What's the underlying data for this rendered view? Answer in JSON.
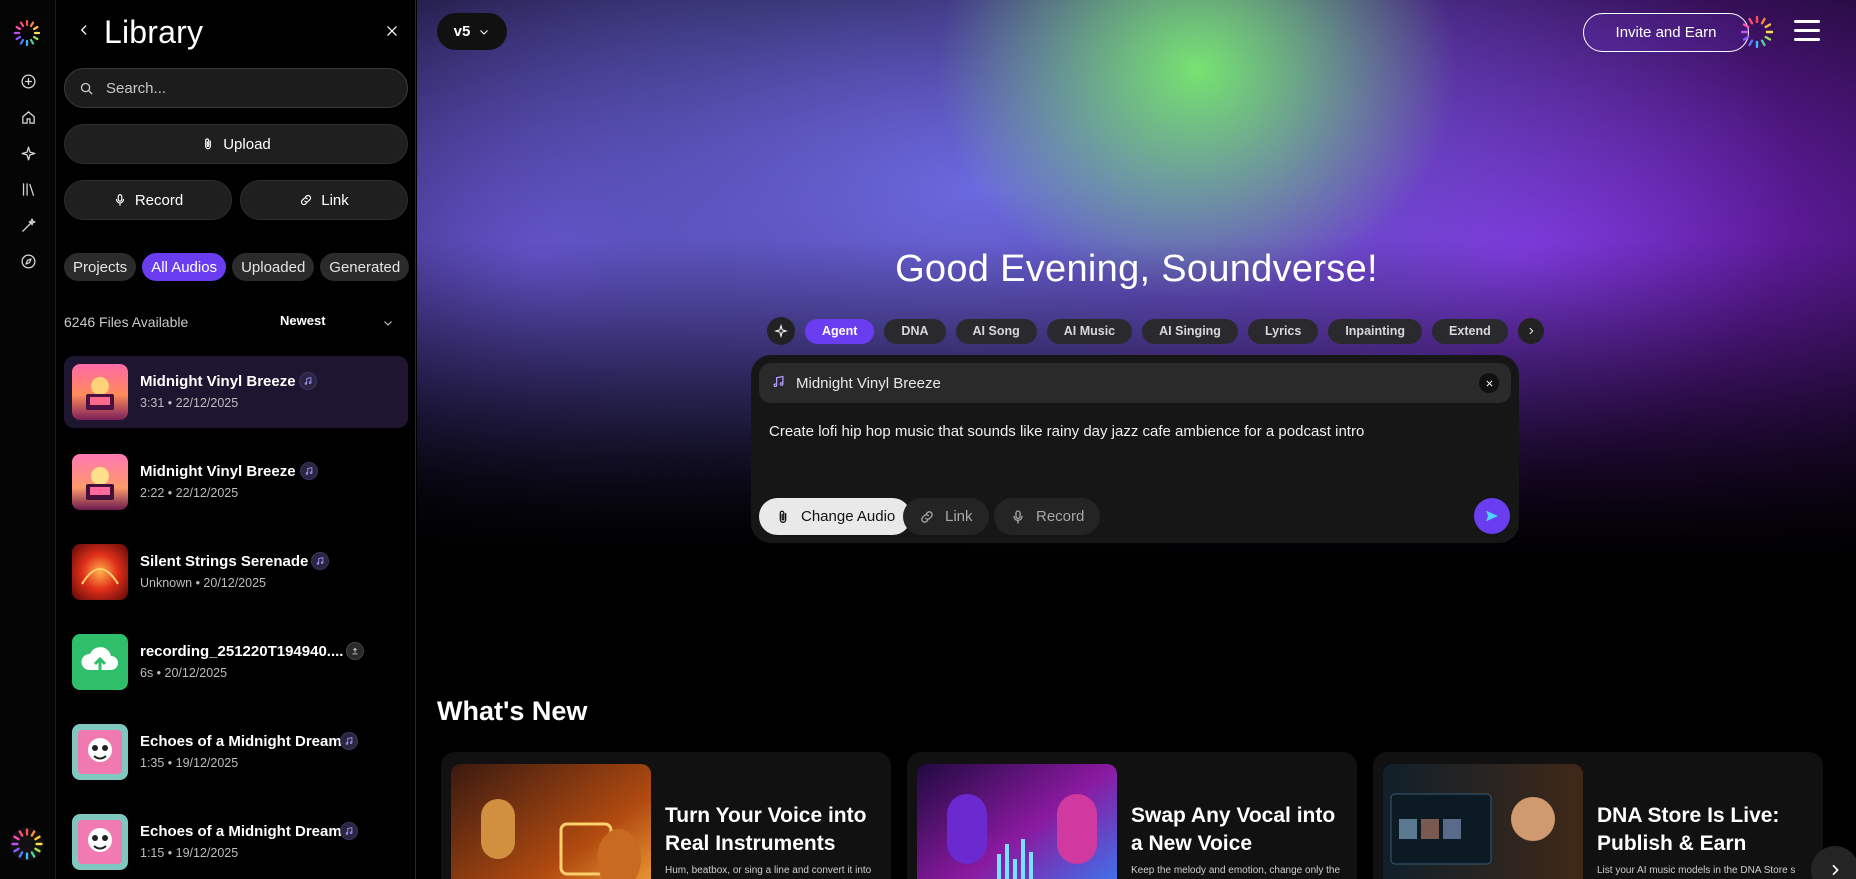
{
  "app": {
    "brand_colors": {
      "accent": "#6a3df0",
      "panel_bg": "#000000",
      "chip_bg": "#2a2a2a"
    }
  },
  "rail": {
    "items": [
      {
        "icon": "plus-circle-icon"
      },
      {
        "icon": "home-icon"
      },
      {
        "icon": "sparkle-icon"
      },
      {
        "icon": "library-icon"
      },
      {
        "icon": "magic-wand-icon"
      },
      {
        "icon": "compass-icon"
      }
    ]
  },
  "library": {
    "title": "Library",
    "search_placeholder": "Search...",
    "upload_label": "Upload",
    "record_label": "Record",
    "link_label": "Link",
    "filters": [
      "Projects",
      "All Audios",
      "Uploaded",
      "Generated"
    ],
    "active_filter": "All Audios",
    "files_count": "6246 Files Available",
    "sort_label": "Newest",
    "items": [
      {
        "title": "Midnight Vinyl Breeze",
        "meta": "3:31 • 22/12/2025",
        "badge": "music-note-icon",
        "selected": true
      },
      {
        "title": "Midnight Vinyl Breeze",
        "meta": "2:22 • 22/12/2025",
        "badge": "music-note-icon",
        "selected": false
      },
      {
        "title": "Silent Strings Serenade",
        "meta": "Unknown • 20/12/2025",
        "badge": "music-note-icon",
        "selected": false
      },
      {
        "title": "recording_251220T194940....",
        "meta": "6s • 20/12/2025",
        "badge": "upload-icon",
        "selected": false
      },
      {
        "title": "Echoes of a Midnight Dream",
        "meta": "1:35 • 19/12/2025",
        "badge": "music-note-icon",
        "selected": false
      },
      {
        "title": "Echoes of a Midnight Dream",
        "meta": "1:15 • 19/12/2025",
        "badge": "music-note-icon",
        "selected": false
      }
    ]
  },
  "header": {
    "version": "v5",
    "invite_label": "Invite and Earn"
  },
  "main": {
    "greeting": "Good Evening, Soundverse!",
    "modes": [
      "Agent",
      "DNA",
      "AI Song",
      "AI Music",
      "AI Singing",
      "Lyrics",
      "Inpainting",
      "Extend"
    ],
    "active_mode": "Agent",
    "composer": {
      "audio_name": "Midnight Vinyl Breeze",
      "prompt": "Create lofi hip hop music that sounds like rainy day jazz cafe ambience for a podcast intro",
      "change_audio_label": "Change Audio",
      "link_label": "Link",
      "record_label": "Record"
    },
    "whats_new_title": "What's New",
    "cards": [
      {
        "title": "Turn Your Voice into Real Instruments",
        "desc": "Hum, beatbox, or sing a line and convert it into"
      },
      {
        "title": "Swap Any Vocal into a New Voice",
        "desc": "Keep the melody and emotion, change only the"
      },
      {
        "title": "DNA Store Is Live: Publish & Earn",
        "desc": "List your AI music models in the DNA Store s"
      }
    ]
  }
}
